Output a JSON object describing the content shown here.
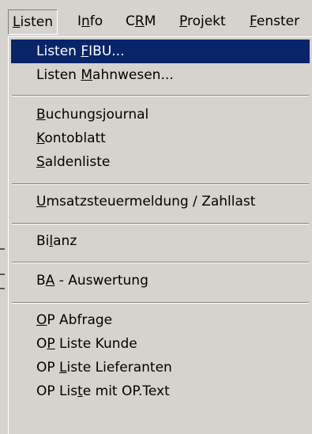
{
  "menubar": {
    "items": [
      {
        "pre": "",
        "key": "L",
        "post": "isten"
      },
      {
        "pre": "I",
        "key": "n",
        "post": "fo"
      },
      {
        "pre": "C",
        "key": "R",
        "post": "M"
      },
      {
        "pre": "",
        "key": "P",
        "post": "rojekt"
      },
      {
        "pre": "",
        "key": "F",
        "post": "enster"
      }
    ]
  },
  "menu": {
    "items": [
      {
        "pre": "Listen ",
        "key": "F",
        "post": "IBU..."
      },
      {
        "pre": "Listen ",
        "key": "M",
        "post": "ahnwesen..."
      },
      {
        "pre": "",
        "key": "B",
        "post": "uchungsjournal"
      },
      {
        "pre": "",
        "key": "K",
        "post": "ontoblatt"
      },
      {
        "pre": "",
        "key": "S",
        "post": "aldenliste"
      },
      {
        "pre": "",
        "key": "U",
        "post": "msatzsteuermeldung / Zahllast"
      },
      {
        "pre": "Bi",
        "key": "l",
        "post": "anz"
      },
      {
        "pre": "B",
        "key": "A",
        "post": " - Auswertung"
      },
      {
        "pre": "",
        "key": "O",
        "post": "P Abfrage"
      },
      {
        "pre": "O",
        "key": "P",
        "post": " Liste Kunde"
      },
      {
        "pre": "OP ",
        "key": "L",
        "post": "iste Lieferanten"
      },
      {
        "pre": "OP Lis",
        "key": "t",
        "post": "e mit OP.Text"
      }
    ]
  }
}
